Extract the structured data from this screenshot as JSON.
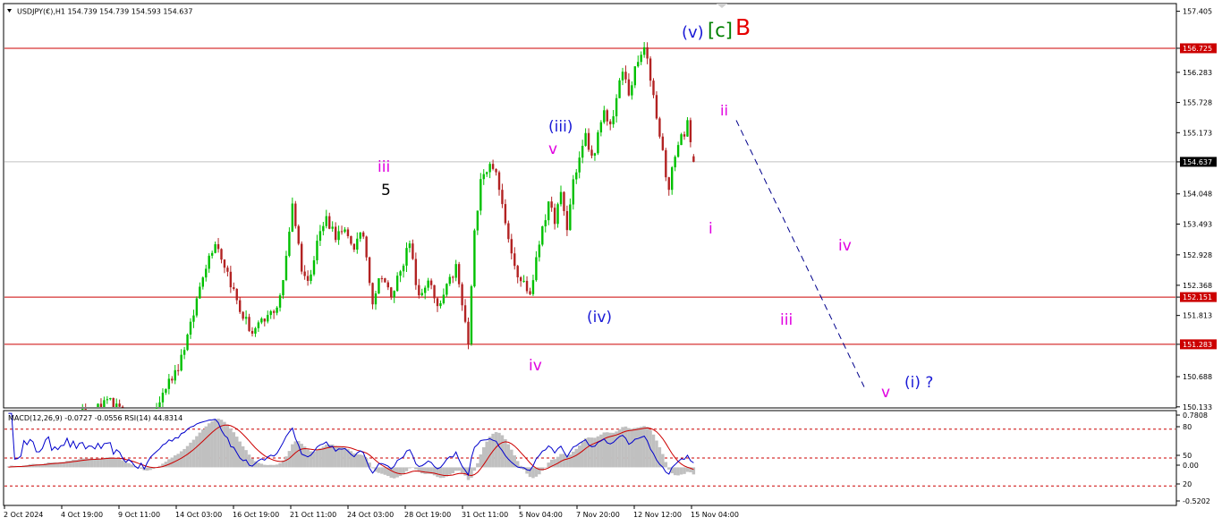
{
  "window": {
    "symbol_line": "USDJPY(€),H1  154.739 154.739 154.593 154.637",
    "indicator_line": "MACD(12,26,9) -0.0727 -0.0556 RSI(14) 44.8314"
  },
  "chart_data": {
    "type": "candlestick",
    "symbol": "USDJPY(€)",
    "timeframe": "H1",
    "ohlc_last": {
      "open": 154.739,
      "high": 154.739,
      "low": 154.593,
      "close": 154.637
    },
    "price_axis_ticks": [
      "157.405",
      "156.725",
      "156.283",
      "155.728",
      "155.173",
      "154.637",
      "154.048",
      "153.493",
      "152.928",
      "152.368",
      "152.151",
      "151.813",
      "151.283",
      "150.688",
      "150.133"
    ],
    "price_ylim": [
      150.13,
      157.53
    ],
    "time_axis_labels": [
      "2 Oct 2024",
      "4 Oct 19:00",
      "9 Oct 11:00",
      "14 Oct 03:00",
      "16 Oct 19:00",
      "21 Oct 11:00",
      "24 Oct 03:00",
      "28 Oct 19:00",
      "31 Oct 11:00",
      "5 Nov 04:00",
      "7 Nov 20:00",
      "12 Nov 12:00",
      "15 Nov 04:00"
    ],
    "horizontal_lines": [
      {
        "label": "156.725",
        "value": 156.725,
        "color": "#cc0000"
      },
      {
        "label": "152.151",
        "value": 152.151,
        "color": "#cc0000"
      },
      {
        "label": "151.283",
        "value": 151.283,
        "color": "#cc0000"
      }
    ],
    "bid_line": {
      "label": "154.637",
      "value": 154.637,
      "color": "#c0c0c0"
    },
    "price_path": [
      [
        0,
        149.5
      ],
      [
        10,
        149.6
      ],
      [
        20,
        149.9
      ],
      [
        30,
        150.1
      ],
      [
        34,
        150.2
      ],
      [
        38,
        150.0
      ],
      [
        45,
        149.6
      ],
      [
        52,
        150.5
      ],
      [
        56,
        150.9
      ],
      [
        60,
        151.6
      ],
      [
        64,
        152.6
      ],
      [
        68,
        153.2
      ],
      [
        72,
        152.6
      ],
      [
        76,
        151.9
      ],
      [
        80,
        151.5
      ],
      [
        84,
        151.7
      ],
      [
        88,
        152.0
      ],
      [
        90,
        152.4
      ],
      [
        93,
        153.9
      ],
      [
        96,
        152.7
      ],
      [
        98,
        152.4
      ],
      [
        101,
        153.2
      ],
      [
        104,
        153.6
      ],
      [
        107,
        153.3
      ],
      [
        110,
        153.3
      ],
      [
        113,
        153.1
      ],
      [
        116,
        153.3
      ],
      [
        119,
        152.1
      ],
      [
        122,
        152.6
      ],
      [
        125,
        152.1
      ],
      [
        128,
        152.7
      ],
      [
        131,
        153.1
      ],
      [
        134,
        152.1
      ],
      [
        137,
        152.5
      ],
      [
        140,
        151.9
      ],
      [
        143,
        152.3
      ],
      [
        146,
        152.7
      ],
      [
        148,
        152.0
      ],
      [
        150,
        151.3
      ],
      [
        152,
        153.3
      ],
      [
        154,
        154.4
      ],
      [
        156,
        154.5
      ],
      [
        158,
        154.6
      ],
      [
        160,
        154.1
      ],
      [
        162,
        153.6
      ],
      [
        164,
        153.0
      ],
      [
        166,
        152.6
      ],
      [
        168,
        152.4
      ],
      [
        170,
        152.2
      ],
      [
        172,
        152.8
      ],
      [
        174,
        153.5
      ],
      [
        176,
        153.8
      ],
      [
        178,
        153.6
      ],
      [
        180,
        154.0
      ],
      [
        182,
        153.4
      ],
      [
        184,
        154.3
      ],
      [
        186,
        154.7
      ],
      [
        188,
        155.1
      ],
      [
        190,
        154.7
      ],
      [
        192,
        155.1
      ],
      [
        194,
        155.5
      ],
      [
        196,
        155.3
      ],
      [
        198,
        155.8
      ],
      [
        200,
        156.3
      ],
      [
        202,
        155.9
      ],
      [
        204,
        156.3
      ],
      [
        206,
        156.6
      ],
      [
        207,
        156.7
      ],
      [
        209,
        156.2
      ],
      [
        211,
        155.5
      ],
      [
        213,
        154.8
      ],
      [
        215,
        154.1
      ],
      [
        217,
        154.8
      ],
      [
        219,
        155.1
      ],
      [
        221,
        155.3
      ],
      [
        223,
        154.6
      ]
    ],
    "projection": {
      "color": "#00008b",
      "style": "dashed",
      "from_price": 155.4,
      "to_price": 150.5
    },
    "wave_labels": [
      {
        "text": "(v)",
        "color": "#1a1ad6"
      },
      {
        "text": "[c]",
        "color": "#008000"
      },
      {
        "text": "B",
        "color": "#e60000"
      },
      {
        "text": "ii",
        "color": "#e000e0"
      },
      {
        "text": "(iii)",
        "color": "#1a1ad6"
      },
      {
        "text": "v",
        "color": "#e000e0"
      },
      {
        "text": "iii",
        "color": "#e000e0"
      },
      {
        "text": "5",
        "color": "#000000"
      },
      {
        "text": "i",
        "color": "#e000e0"
      },
      {
        "text": "iv",
        "color": "#e000e0"
      },
      {
        "text": "(iv)",
        "color": "#1a1ad6"
      },
      {
        "text": "iii",
        "color": "#e000e0"
      },
      {
        "text": "iv",
        "color": "#e000e0"
      },
      {
        "text": "v",
        "color": "#e000e0"
      },
      {
        "text": "(i) ?",
        "color": "#1a1ad6"
      }
    ],
    "indicator": {
      "name": "MACD(12,26,9) RSI(14)",
      "macd": -0.0727,
      "signal": -0.0556,
      "rsi": 44.8314,
      "axis_ticks": [
        "0.7808",
        "80",
        "50",
        "0.00",
        "20",
        "-0.5202"
      ],
      "macd_ylim": [
        -0.5202,
        0.7808
      ],
      "rsi_levels": [
        80,
        50,
        20
      ]
    },
    "colors": {
      "bull_candle": "#00c000",
      "bear_candle": "#b22222",
      "rsi_line": "#0000cc",
      "signal_line": "#cc0000",
      "histogram": "#c0c0c0",
      "level_line": "#cc0000"
    }
  }
}
